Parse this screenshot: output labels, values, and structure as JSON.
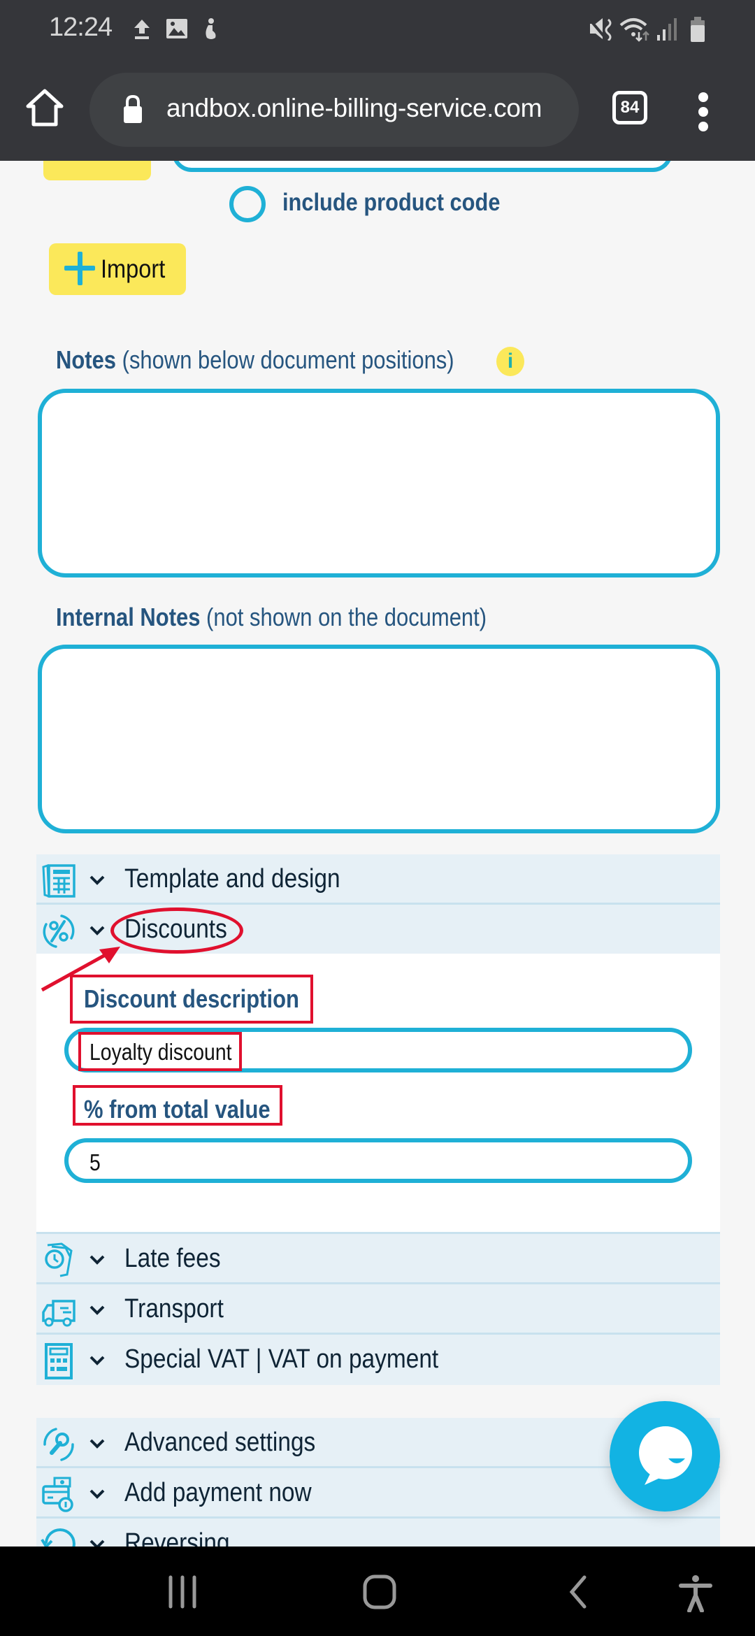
{
  "status_bar": {
    "time": "12:24",
    "left_icons": [
      "upload-icon",
      "image-icon",
      "notification-icon"
    ],
    "right_icons": [
      "vibrate-mute-icon",
      "wifi-icon",
      "signal-icon",
      "battery-icon"
    ]
  },
  "browser": {
    "url": "andbox.online-billing-service.com",
    "tab_count": "84",
    "home_icon": "home-icon",
    "lock_icon": "lock-icon",
    "menu_icon": "more-vert-icon"
  },
  "form": {
    "include_product_code_label": "include product code",
    "import_button_label": "Import",
    "notes": {
      "label_bold": "Notes",
      "label_hint": " (shown below document positions)",
      "info_badge": "i",
      "value": ""
    },
    "internal_notes": {
      "label_bold": "Internal Notes",
      "label_hint": " (not shown on the document)",
      "value": ""
    }
  },
  "accordion_top": [
    {
      "label": "Template and design",
      "icon": "template-icon"
    },
    {
      "label": "Discounts",
      "icon": "discount-percent-icon"
    }
  ],
  "discounts": {
    "description_label": "Discount description",
    "description_value": "Loyalty discount",
    "percent_label": "% from total value",
    "percent_value": "5"
  },
  "accordion_middle": [
    {
      "label": "Late fees",
      "icon": "late-fees-icon"
    },
    {
      "label": "Transport",
      "icon": "truck-icon"
    },
    {
      "label": "Special VAT | VAT on payment",
      "icon": "calculator-icon"
    }
  ],
  "accordion_bottom": [
    {
      "label": "Advanced settings",
      "icon": "wrench-icon"
    },
    {
      "label": "Add payment now",
      "icon": "payment-icon"
    },
    {
      "label": "Reversing",
      "icon": "undo-icon"
    }
  ],
  "chat": {
    "icon": "chat-bubble-icon"
  },
  "colors": {
    "accent": "#1fb0d6",
    "label_blue": "#26557f",
    "yellow": "#fbe85a",
    "annotation_red": "#e0102e",
    "accordion_bg": "#e6f0f6"
  },
  "nav_bar": [
    "recent-apps-icon",
    "home-nav-icon",
    "back-icon",
    "accessibility-icon"
  ]
}
